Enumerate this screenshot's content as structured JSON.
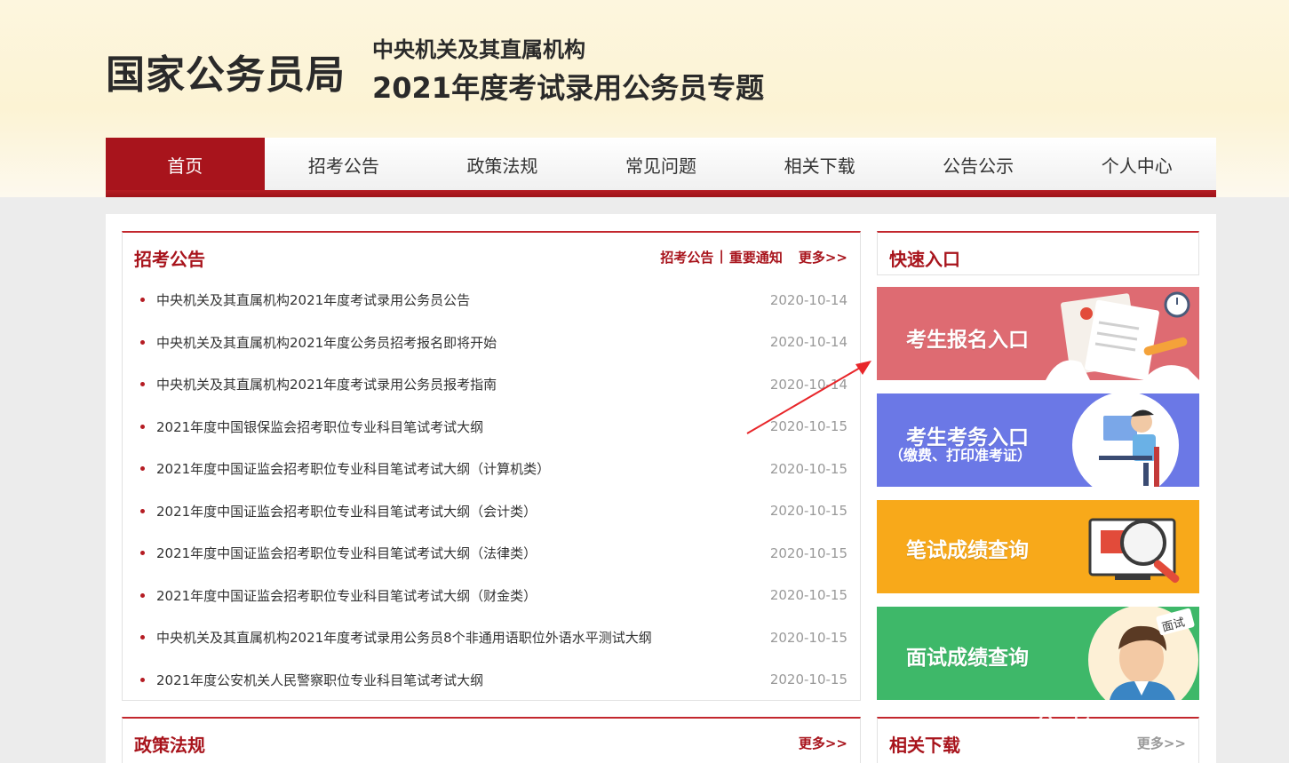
{
  "header": {
    "logo_text": "国家公务员局",
    "subtitle_1": "中央机关及其直属机构",
    "subtitle_2": "2021年度考试录用公务员专题"
  },
  "nav": {
    "items": [
      {
        "label": "首页",
        "active": true
      },
      {
        "label": "招考公告"
      },
      {
        "label": "政策法规"
      },
      {
        "label": "常见问题"
      },
      {
        "label": "相关下载"
      },
      {
        "label": "公告公示"
      },
      {
        "label": "个人中心"
      }
    ]
  },
  "recruit_panel": {
    "title": "招考公告",
    "link_1": "招考公告",
    "separator": "|",
    "link_2": "重要通知",
    "more": "更多>>",
    "items": [
      {
        "title": "中央机关及其直属机构2021年度考试录用公务员公告",
        "date": "2020-10-14"
      },
      {
        "title": "中央机关及其直属机构2021年度公务员招考报名即将开始",
        "date": "2020-10-14"
      },
      {
        "title": "中央机关及其直属机构2021年度考试录用公务员报考指南",
        "date": "2020-10-14"
      },
      {
        "title": "2021年度中国银保监会招考职位专业科目笔试考试大纲",
        "date": "2020-10-15"
      },
      {
        "title": "2021年度中国证监会招考职位专业科目笔试考试大纲（计算机类）",
        "date": "2020-10-15"
      },
      {
        "title": "2021年度中国证监会招考职位专业科目笔试考试大纲（会计类）",
        "date": "2020-10-15"
      },
      {
        "title": "2021年度中国证监会招考职位专业科目笔试考试大纲（法律类）",
        "date": "2020-10-15"
      },
      {
        "title": "2021年度中国证监会招考职位专业科目笔试考试大纲（财金类）",
        "date": "2020-10-15"
      },
      {
        "title": "中央机关及其直属机构2021年度考试录用公务员8个非通用语职位外语水平测试大纲",
        "date": "2020-10-15"
      },
      {
        "title": "2021年度公安机关人民警察职位专业科目笔试考试大纲",
        "date": "2020-10-15"
      }
    ]
  },
  "quick_panel": {
    "title": "快速入口",
    "entries": [
      {
        "label": "考生报名入口",
        "color": "#de6b72"
      },
      {
        "label": "考生考务入口",
        "sublabel": "（缴费、打印准考证）",
        "color": "#6b78e6"
      },
      {
        "label": "笔试成绩查询",
        "color": "#f8a91a"
      },
      {
        "label": "面试成绩查询",
        "color": "#3eb869",
        "badge": "面试"
      }
    ]
  },
  "policy_panel": {
    "title": "政策法规",
    "more": "更多>>"
  },
  "download_panel": {
    "title": "相关下载",
    "more": "更多>>"
  },
  "watermark": "公考"
}
